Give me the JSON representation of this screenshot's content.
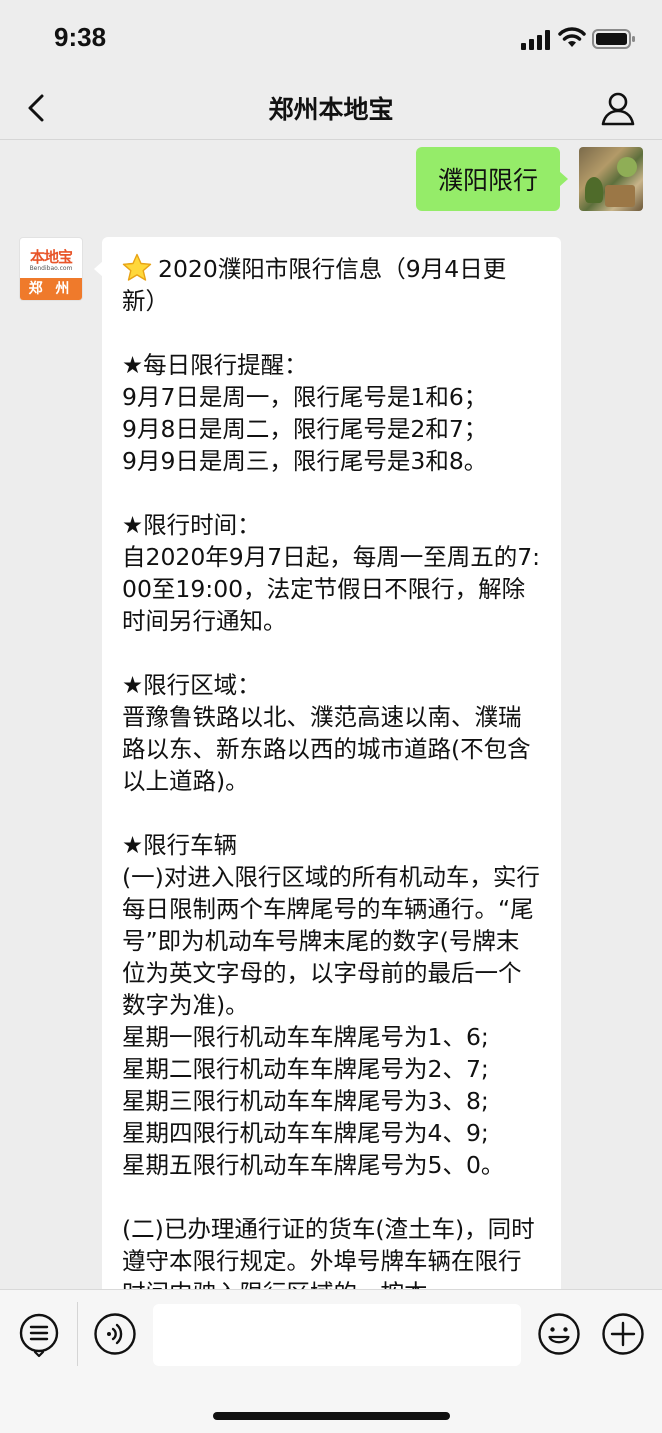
{
  "status_bar": {
    "time": "9:38"
  },
  "nav": {
    "title": "郑州本地宝"
  },
  "messages": {
    "user_text": "濮阳限行",
    "bot_avatar": {
      "logo": "本地宝",
      "url": "Bendibao.com",
      "city": "郑 州"
    },
    "bot_text": "2020濮阳市限行信息（9月4日更新）\n\n★每日限行提醒：\n9月7日是周一，限行尾号是1和6；\n9月8日是周二，限行尾号是2和7；\n9月9日是周三，限行尾号是3和8。\n\n★限行时间：\n自2020年9月7日起，每周一至周五的7: 00至19:00，法定节假日不限行，解除时间另行通知。\n\n★限行区域：\n晋豫鲁铁路以北、濮范高速以南、濮瑞路以东、新东路以西的城市道路(不包含以上道路)。\n\n★限行车辆\n(一)对进入限行区域的所有机动车，实行每日限制两个车牌尾号的车辆通行。“尾号”即为机动车号牌末尾的数字(号牌末位为英文字母的，以字母前的最后一个数字为准)。\n星期一限行机动车车牌尾号为1、6;\n星期二限行机动车车牌尾号为2、7;\n星期三限行机动车车牌尾号为3、8;\n星期四限行机动车车牌尾号为4、9;\n星期五限行机动车车牌尾号为5、0。\n\n(二)已办理通行证的货车(渣土车)，同时遵守本限行规定。外埠号牌车辆在限行时间内驶入限行区域的，按本"
  },
  "input": {
    "value": "",
    "placeholder": ""
  },
  "icons": {
    "back": "chevron-left-icon",
    "profile": "person-icon",
    "menu": "menu-list-icon",
    "voice": "voice-icon",
    "emoji": "smiley-icon",
    "plus": "plus-icon",
    "star": "star-emoji"
  },
  "colors": {
    "user_bubble": "#95ec69",
    "background": "#ededed",
    "logo_orange": "#ef7a2b"
  }
}
